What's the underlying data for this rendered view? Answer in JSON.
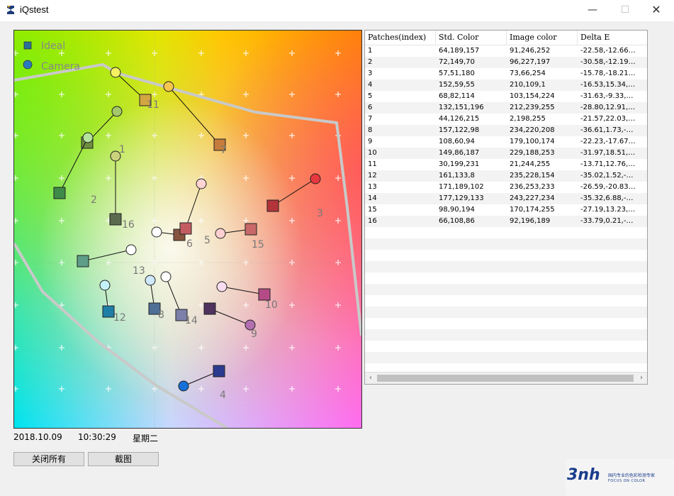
{
  "window": {
    "title": "iQstest"
  },
  "legend": {
    "ideal": "Ideal",
    "camera": "Camera"
  },
  "table": {
    "headers": [
      "Patches(index)",
      "Std. Color",
      "Image color",
      "Delta E"
    ],
    "rows": [
      [
        "1",
        "64,189,157",
        "91,246,252",
        "-22.58,-12.66…"
      ],
      [
        "2",
        "72,149,70",
        "96,227,197",
        "-30.58,-12.19…"
      ],
      [
        "3",
        "57,51,180",
        "73,66,254",
        "-15.78,-18.21…"
      ],
      [
        "4",
        "152,59,55",
        "210,109,1",
        "-16.53,15.34,…"
      ],
      [
        "5",
        "68,82,114",
        "103,154,224",
        "-31.63,-9.33,…"
      ],
      [
        "6",
        "132,151,196",
        "212,239,255",
        "-28.80,12.91,…"
      ],
      [
        "7",
        "44,126,215",
        "2,198,255",
        "-21.57,22.03,…"
      ],
      [
        "8",
        "157,122,98",
        "234,220,208",
        "-36.61,1.73,-…"
      ],
      [
        "9",
        "108,60,94",
        "179,100,174",
        "-22.23,-17.67…"
      ],
      [
        "10",
        "149,86,187",
        "229,188,253",
        "-31.97,18.51,…"
      ],
      [
        "11",
        "30,199,231",
        "21,244,255",
        "-13.71,12.76,…"
      ],
      [
        "12",
        "161,133,8",
        "235,228,154",
        "-35.02,1.52,-…"
      ],
      [
        "13",
        "171,189,102",
        "236,253,233",
        "-26.59,-20.83…"
      ],
      [
        "14",
        "177,129,133",
        "243,227,234",
        "-35.32,6.88,-…"
      ],
      [
        "15",
        "98,90,194",
        "170,174,255",
        "-27.19,13.23,…"
      ],
      [
        "16",
        "66,108,86",
        "92,196,189",
        "-33.79,0.21,-…"
      ]
    ]
  },
  "status": {
    "date": "2018.10.09",
    "time": "10:30:29",
    "weekday": "星期二"
  },
  "buttons": {
    "close_all": "关闭所有",
    "screenshot": "截图"
  },
  "logo": {
    "brand": "3nh",
    "tagline": "FOCUS ON COLOR",
    "tagline_cn": "国内专业的色彩检测专家"
  },
  "patches": [
    {
      "label": "1",
      "ideal": "#6f8e3f",
      "camera": "#a2c86a"
    },
    {
      "label": "2",
      "ideal": "#3e8a48",
      "camera": "#b4e39b"
    },
    {
      "label": "3",
      "ideal": "#b3343a",
      "camera": "#e8383f"
    },
    {
      "label": "4",
      "ideal": "#2c3a8e",
      "camera": "#1570d8"
    },
    {
      "label": "5",
      "ideal": "#c86868",
      "camera": "#fdcfd0"
    },
    {
      "label": "6",
      "ideal": "#86543f",
      "camera": "#ffffff"
    },
    {
      "label": "7",
      "ideal": "#c57c3c",
      "camera": "#f6c64e"
    },
    {
      "label": "8",
      "ideal": "#4f6f96",
      "camera": "#cfe9ff"
    },
    {
      "label": "9",
      "ideal": "#50325e",
      "camera": "#b26eb0"
    },
    {
      "label": "10",
      "ideal": "#b54c87",
      "camera": "#f8ddf1"
    },
    {
      "label": "11",
      "ideal": "#d3a641",
      "camera": "#f5f060"
    },
    {
      "label": "12",
      "ideal": "#1f7ea5",
      "camera": "#c5f2f8"
    },
    {
      "label": "13",
      "ideal": "#5e9e88",
      "camera": "#ffffff"
    },
    {
      "label": "14",
      "ideal": "#7c7fa8",
      "camera": "#ffffff"
    },
    {
      "label": "15",
      "ideal": "#c25c61",
      "camera": "#ffd4d4"
    },
    {
      "label": "16",
      "ideal": "#5b6b4e",
      "camera": "#cbd27c"
    }
  ]
}
